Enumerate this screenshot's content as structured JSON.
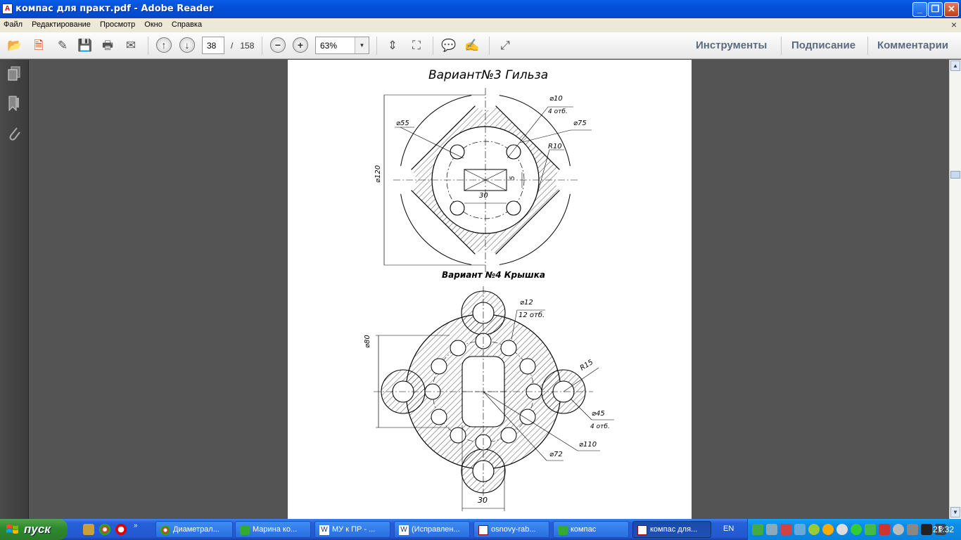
{
  "window": {
    "title": "компас для практ.pdf - Adobe Reader",
    "app_icon": "adobe-pdf-icon"
  },
  "menu": [
    "Файл",
    "Редактирование",
    "Просмотр",
    "Окно",
    "Справка"
  ],
  "toolbar": {
    "page_current": "38",
    "page_separator": "/",
    "page_total": "158",
    "zoom": "63%",
    "tools_label": "Инструменты",
    "sign_label": "Подписание",
    "comments_label": "Комментарии"
  },
  "document": {
    "variant3_title": "Вариант№3   Гильза",
    "variant3_dims": {
      "d10": "⌀10",
      "count4": "4 отб.",
      "d75": "⌀75",
      "d55": "⌀55",
      "r10": "R10",
      "d120": "⌀120",
      "w30": "30",
      "w5": "5"
    },
    "variant4_title": "Вариант №4 Крышка",
    "variant4_dims": {
      "d12": "⌀12",
      "count12": "12 отб.",
      "d80": "⌀80",
      "r15": "R15",
      "d45": "⌀45",
      "count4": "4 отб.",
      "d110": "⌀110",
      "d72": "⌀72",
      "w30": "30"
    }
  },
  "taskbar": {
    "start_label": "пуск",
    "tasks": [
      "Диаметрал...",
      "Марина ко...",
      "МУ к ПР - ...",
      "(Исправлен...",
      "osnovy-rab...",
      "компас",
      "компас для..."
    ],
    "language": "EN",
    "clock": "21:32"
  },
  "colors": {
    "title_bar": "#0550d8",
    "taskbar": "#2458d0",
    "start_green": "#2f8c2f",
    "doc_bg": "#545454"
  }
}
